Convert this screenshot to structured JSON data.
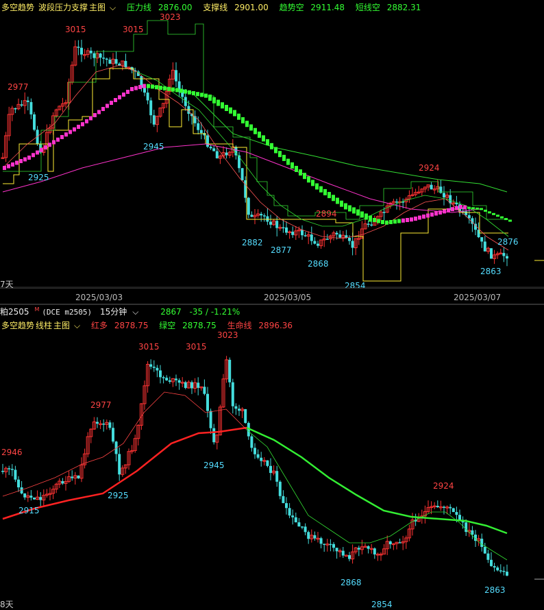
{
  "top_panel": {
    "legend": {
      "indicator": "多空趋势",
      "sub": "波段压力支撑",
      "main": "主图",
      "pressure_label": "压力线",
      "pressure_value": "2876.00",
      "support_label": "支撑线",
      "support_value": "2901.00",
      "trend_label": "趋势空",
      "trend_value": "2911.48",
      "short_label": "短线空",
      "short_value": "2882.31"
    },
    "peaks": [
      "3015",
      "3015",
      "3023",
      "2977",
      "2945",
      "2925",
      "2924",
      "2894",
      "2882",
      "2877",
      "2868",
      "2854",
      "2876",
      "2863"
    ],
    "days_label": "7天"
  },
  "axis": {
    "dates": [
      "2025/03/03",
      "2025/03/05",
      "2025/03/07"
    ]
  },
  "info_bar": {
    "symbol": "粕2505",
    "badge": "M",
    "exchange": "(DCE m2505)",
    "period": "15分钟",
    "price": "2867",
    "change": "-35 / -1.21%"
  },
  "bottom_panel": {
    "legend": {
      "indicator": "多空趋势",
      "sub": "线柱",
      "main": "主图",
      "red_label": "红多",
      "red_value": "2878.75",
      "green_label": "绿空",
      "green_value": "2878.75",
      "life_label": "生命线",
      "life_value": "2896.36"
    },
    "peaks": [
      "3023",
      "3015",
      "3015",
      "2977",
      "2946",
      "2945",
      "2915",
      "2925",
      "2924",
      "2868",
      "2863",
      "2854"
    ],
    "days_label": "8天"
  },
  "colors": {
    "up": "#ff3333",
    "down": "#44dddd",
    "green_line": "#33ff33",
    "magenta": "#ff33cc",
    "yellow": "#ffee33",
    "blue_text": "#55ddff",
    "legend_yellow": "#ffee66"
  }
}
